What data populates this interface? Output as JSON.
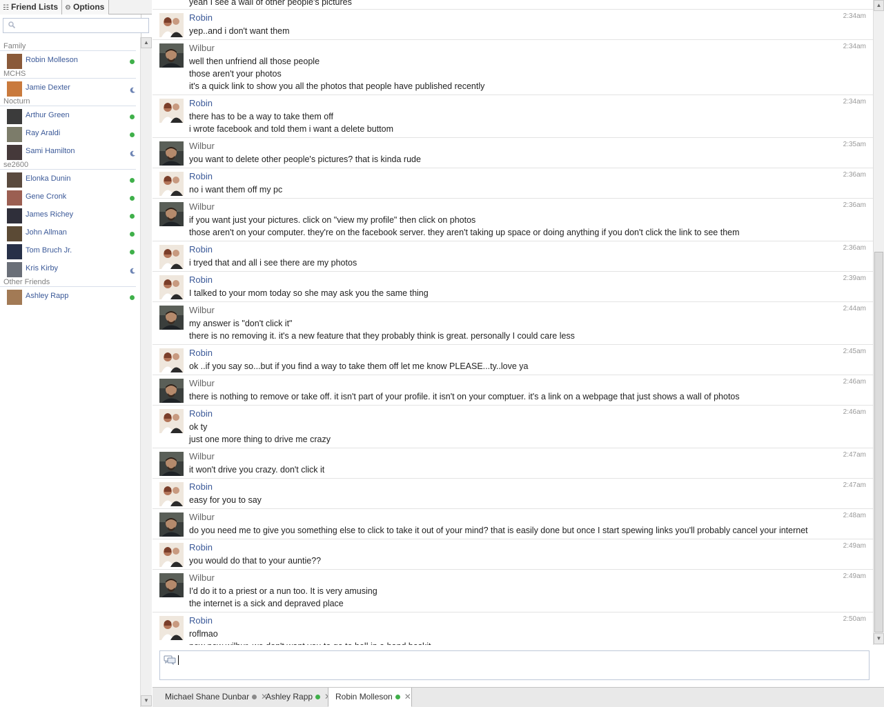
{
  "sidebar": {
    "tabs": {
      "friend_lists": "Friend Lists",
      "options": "Options"
    },
    "search": {
      "placeholder": ""
    },
    "groups": [
      {
        "title": "Family",
        "friends": [
          {
            "name": "Robin Molleson",
            "status": "online"
          }
        ]
      },
      {
        "title": "MCHS",
        "friends": [
          {
            "name": "Jamie Dexter",
            "status": "idle"
          }
        ]
      },
      {
        "title": "Nocturn",
        "friends": [
          {
            "name": "Arthur Green",
            "status": "online"
          },
          {
            "name": "Ray Araldi",
            "status": "online"
          },
          {
            "name": "Sami Hamilton",
            "status": "idle"
          }
        ]
      },
      {
        "title": "se2600",
        "friends": [
          {
            "name": "Elonka Dunin",
            "status": "online"
          },
          {
            "name": "Gene Cronk",
            "status": "online"
          },
          {
            "name": "James Richey",
            "status": "online"
          },
          {
            "name": "John Allman",
            "status": "online"
          },
          {
            "name": "Tom Bruch Jr.",
            "status": "online"
          },
          {
            "name": "Kris Kirby",
            "status": "idle"
          }
        ]
      },
      {
        "title": "Other Friends",
        "friends": [
          {
            "name": "Ashley Rapp",
            "status": "online"
          }
        ]
      }
    ]
  },
  "conversation": {
    "partial_top": "yeah I see a wall of other people's pictures",
    "messages": [
      {
        "sender": "Robin",
        "time": "2:34am",
        "lines": [
          "yep..and i don't want them"
        ]
      },
      {
        "sender": "Wilbur",
        "time": "2:34am",
        "lines": [
          "well then unfriend all those people",
          "those aren't your photos",
          "it's a quick link to show you all the photos that people have published recently"
        ]
      },
      {
        "sender": "Robin",
        "time": "2:34am",
        "lines": [
          "there has to be a way to take them off",
          "i wrote facebook and told them i want a delete buttom"
        ]
      },
      {
        "sender": "Wilbur",
        "time": "2:35am",
        "lines": [
          "you want to delete other people's pictures? that is kinda rude"
        ]
      },
      {
        "sender": "Robin",
        "time": "2:36am",
        "lines": [
          "no i want them off my pc"
        ]
      },
      {
        "sender": "Wilbur",
        "time": "2:36am",
        "lines": [
          "if you want just your pictures. click on \"view my profile\" then click on photos",
          "those aren't on your computer. they're on the facebook server. they aren't taking up space or doing anything if you don't click the link to see them"
        ]
      },
      {
        "sender": "Robin",
        "time": "2:36am",
        "lines": [
          "i tryed that and all i see there are my photos"
        ]
      },
      {
        "sender": "Robin",
        "time": "2:39am",
        "lines": [
          "I talked to your mom today so she may ask you the same thing"
        ]
      },
      {
        "sender": "Wilbur",
        "time": "2:44am",
        "lines": [
          "my answer is \"don't click it\"",
          "there is no removing it. it's a new feature that they probably think is great. personally I could care less"
        ]
      },
      {
        "sender": "Robin",
        "time": "2:45am",
        "lines": [
          "ok ..if you say so...but if you find a way to take them off let me know PLEASE...ty..love ya"
        ]
      },
      {
        "sender": "Wilbur",
        "time": "2:46am",
        "lines": [
          "there is nothing to remove or take off. it isn't part of your profile. it isn't on your comptuer. it's a link on a webpage that just shows a wall of photos"
        ]
      },
      {
        "sender": "Robin",
        "time": "2:46am",
        "lines": [
          "ok ty",
          "just one more thing to drive me crazy"
        ]
      },
      {
        "sender": "Wilbur",
        "time": "2:47am",
        "lines": [
          "it won't drive you crazy. don't click it"
        ]
      },
      {
        "sender": "Robin",
        "time": "2:47am",
        "lines": [
          "easy for you to say"
        ]
      },
      {
        "sender": "Wilbur",
        "time": "2:48am",
        "lines": [
          "do you need me to give you something else to click to take it out of your mind? that is easily done but once I start spewing links you'll probably cancel your internet"
        ]
      },
      {
        "sender": "Robin",
        "time": "2:49am",
        "lines": [
          "you would do that to your auntie??"
        ]
      },
      {
        "sender": "Wilbur",
        "time": "2:49am",
        "lines": [
          "I'd do it to a priest or a nun too. It is very amusing",
          "the internet is a sick and depraved place"
        ]
      },
      {
        "sender": "Robin",
        "time": "2:50am",
        "lines": [
          "roflmao",
          "now now wilbur, we don't want you to go to hell in a hand baskit"
        ]
      }
    ]
  },
  "input": {
    "value": ""
  },
  "chat_tabs": [
    {
      "name": "Michael Shane Dunbar",
      "status": "idle-gray",
      "active": false
    },
    {
      "name": "Ashley Rapp",
      "status": "online",
      "active": false
    },
    {
      "name": "Robin Molleson",
      "status": "online",
      "active": true
    }
  ],
  "colors": {
    "link": "#3b5998",
    "online": "#3fb04a",
    "idle": "#6d84b4",
    "wilbur_name": "#666666"
  }
}
